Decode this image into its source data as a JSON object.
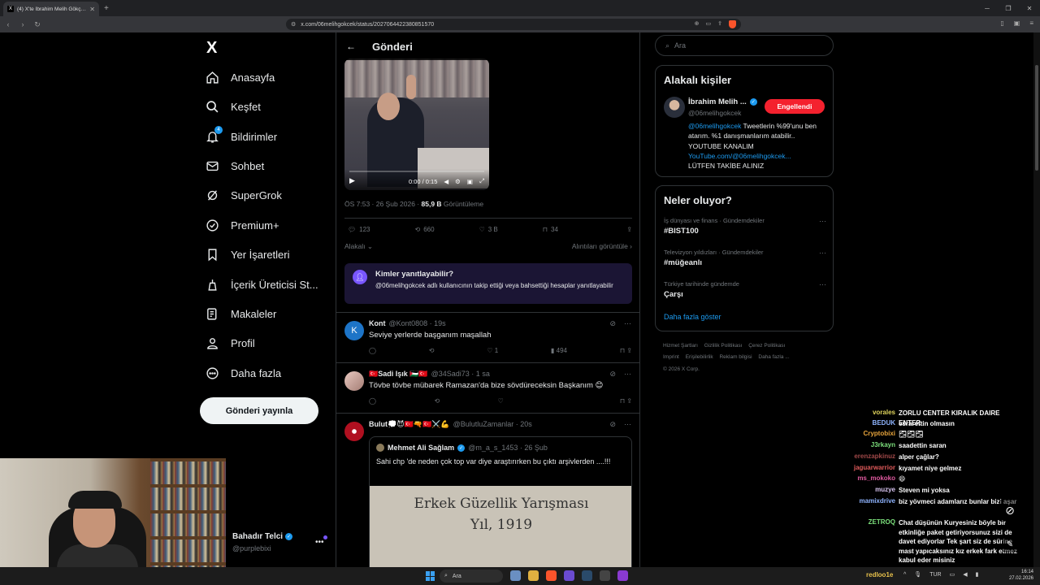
{
  "browser": {
    "tab_title": "(4) X'te İbrahim Melih Gökçek: \"...",
    "new_tab": "+",
    "url": "x.com/06melihgokcek/status/2027064422380851570"
  },
  "sidebar": {
    "logo": "X",
    "items": [
      {
        "label": "Anasayfa",
        "icon": "home-icon"
      },
      {
        "label": "Keşfet",
        "icon": "search-icon"
      },
      {
        "label": "Bildirimler",
        "icon": "bell-icon",
        "badge": "4"
      },
      {
        "label": "Sohbet",
        "icon": "mail-icon"
      },
      {
        "label": "SuperGrok",
        "icon": "grok-icon"
      },
      {
        "label": "Premium+",
        "icon": "verified-icon"
      },
      {
        "label": "Yer İşaretleri",
        "icon": "bookmark-icon"
      },
      {
        "label": "İçerik Üreticisi St...",
        "icon": "creator-icon"
      },
      {
        "label": "Makaleler",
        "icon": "article-icon"
      },
      {
        "label": "Profil",
        "icon": "person-icon"
      },
      {
        "label": "Daha fazla",
        "icon": "more-circle-icon"
      }
    ],
    "post_button": "Gönderi yayınla",
    "account": {
      "name": "Bahadır Telci",
      "handle": "@purplebixi",
      "more": "•••"
    }
  },
  "main": {
    "title": "Gönderi",
    "video": {
      "time": "0:00 / 0:15"
    },
    "meta": {
      "time": "ÖS 7:53 · 26 Şub 2026 · ",
      "views": "85,9 B",
      "views_label": " Görüntüleme"
    },
    "actions": {
      "replies": "123",
      "reposts": "660",
      "likes": "3 B",
      "bookmarks": "34"
    },
    "sort": {
      "left": "Alakalı",
      "right": "Alıntıları görüntüle"
    },
    "who_can_reply": {
      "title": "Kimler yanıtlayabilir?",
      "text": "@06melihgokcek adlı kullanıcının takip ettiği veya bahsettiği hesaplar yanıtlayabilir"
    },
    "replies": [
      {
        "avatar": "K",
        "name": "Kont",
        "handle": "@Kont0808 · 19s",
        "text": "Seviye yerlerde başganım maşallah",
        "likes": "1",
        "views": "494"
      },
      {
        "avatar": "",
        "name": "🇹🇷Sadi Işık 🇵🇸🇹🇷",
        "handle": "@34Sadi73 · 1 sa",
        "text": "Tövbe tövbe mübarek Ramazan'da bize sövdüreceksin Başkanım 😊",
        "likes": "",
        "views": ""
      },
      {
        "avatar": "",
        "name": "Bulut💭😈🇹🇷🔫🇹🇷⚔️💪",
        "handle": "@BulutluZamanlar · 20s",
        "text": "",
        "likes": "",
        "views": ""
      }
    ],
    "quote": {
      "name": "Mehmet Ali Sağlam",
      "handle": "@m_a_s_1453 · 26 Şub",
      "text": "Sahi chp 'de neden çok top var diye araştırırken  bu  çıktı arşivlerden ....!!!",
      "image_line1": "Erkek Güzellik Yarışması",
      "image_line2": "Yıl, 1919"
    }
  },
  "right": {
    "search_placeholder": "Ara",
    "related": {
      "title": "Alakalı kişiler",
      "name": "İbrahim Melih ...",
      "handle": "@06melihgokcek",
      "button": "Engellendi",
      "bio_link1": "@06melihgokcek",
      "bio_text1": " Tweetlerin %99'unu ben atarım. %1 danışmanlarım atabilir.. YOUTUBE KANALIM",
      "bio_link2": "YouTube.com/@06melihgokcek...",
      "bio_text2": "LÜTFEN TAKİBE ALINIZ"
    },
    "trends": {
      "title": "Neler oluyor?",
      "items": [
        {
          "meta": "İş dünyası ve finans · Gündemdekiler",
          "name": "#BIST100"
        },
        {
          "meta": "Televizyon yıldızları · Gündemdekiler",
          "name": "#müğeanlı"
        },
        {
          "meta": "Türkiye tarihinde gündemde",
          "name": "Çarşı"
        }
      ],
      "show_more": "Daha fazla göster"
    },
    "footer": [
      "Hizmet Şartları",
      "Gizlilik Politikası",
      "Çerez Politikası",
      "Imprint",
      "Erişilebilirlik",
      "Reklam bilgisi",
      "Daha fazla ...",
      "© 2026 X Corp."
    ]
  },
  "chat": [
    {
      "user": "vorales",
      "color": "#e0d45c",
      "msg": "ZORLU CENTER KIRALIK DAIRE ENTER"
    },
    {
      "user": "BEDUK",
      "color": "#8fb4ff",
      "msg": "esrarettin olmasın"
    },
    {
      "user": "Cryptobixi",
      "color": "#e7a43c",
      "msg": "🌫🌫🌫"
    },
    {
      "user": "J3rkayn",
      "color": "#7ce07c",
      "msg": "saadettin saran"
    },
    {
      "user": "erenzapkinuz",
      "color": "#a04848",
      "msg": "alper çağlar?"
    },
    {
      "user": "jaguarwarrior",
      "color": "#e05a5a",
      "msg": "kıyamet niye gelmez"
    },
    {
      "user": "ms_mokoko",
      "color": "#e05aa0",
      "msg": "😄"
    },
    {
      "user": "muzye",
      "color": "#d8c4f0",
      "msg": "Steven mi yoksa"
    },
    {
      "user": "mamixdrive",
      "color": "#8fb4ff",
      "msg": "biz yövmeci adamlarız bunlar bizi aşar"
    },
    {
      "user": "ZETROQ",
      "color": "#7ce07c",
      "msg": "Chat düşünün Kuryesiniz böyle bir etkinliğe paket getiriyorsunuz sizi de davet ediyorlar Tek şart siz de sürine mast yapıcaksınız kız erkek fark etmez kabul eder misiniz"
    }
  ],
  "taskbar": {
    "search": "Ara",
    "streamer": "redloo1e",
    "lang": "TUR",
    "time": "16:14",
    "date": "27.02.2026"
  }
}
